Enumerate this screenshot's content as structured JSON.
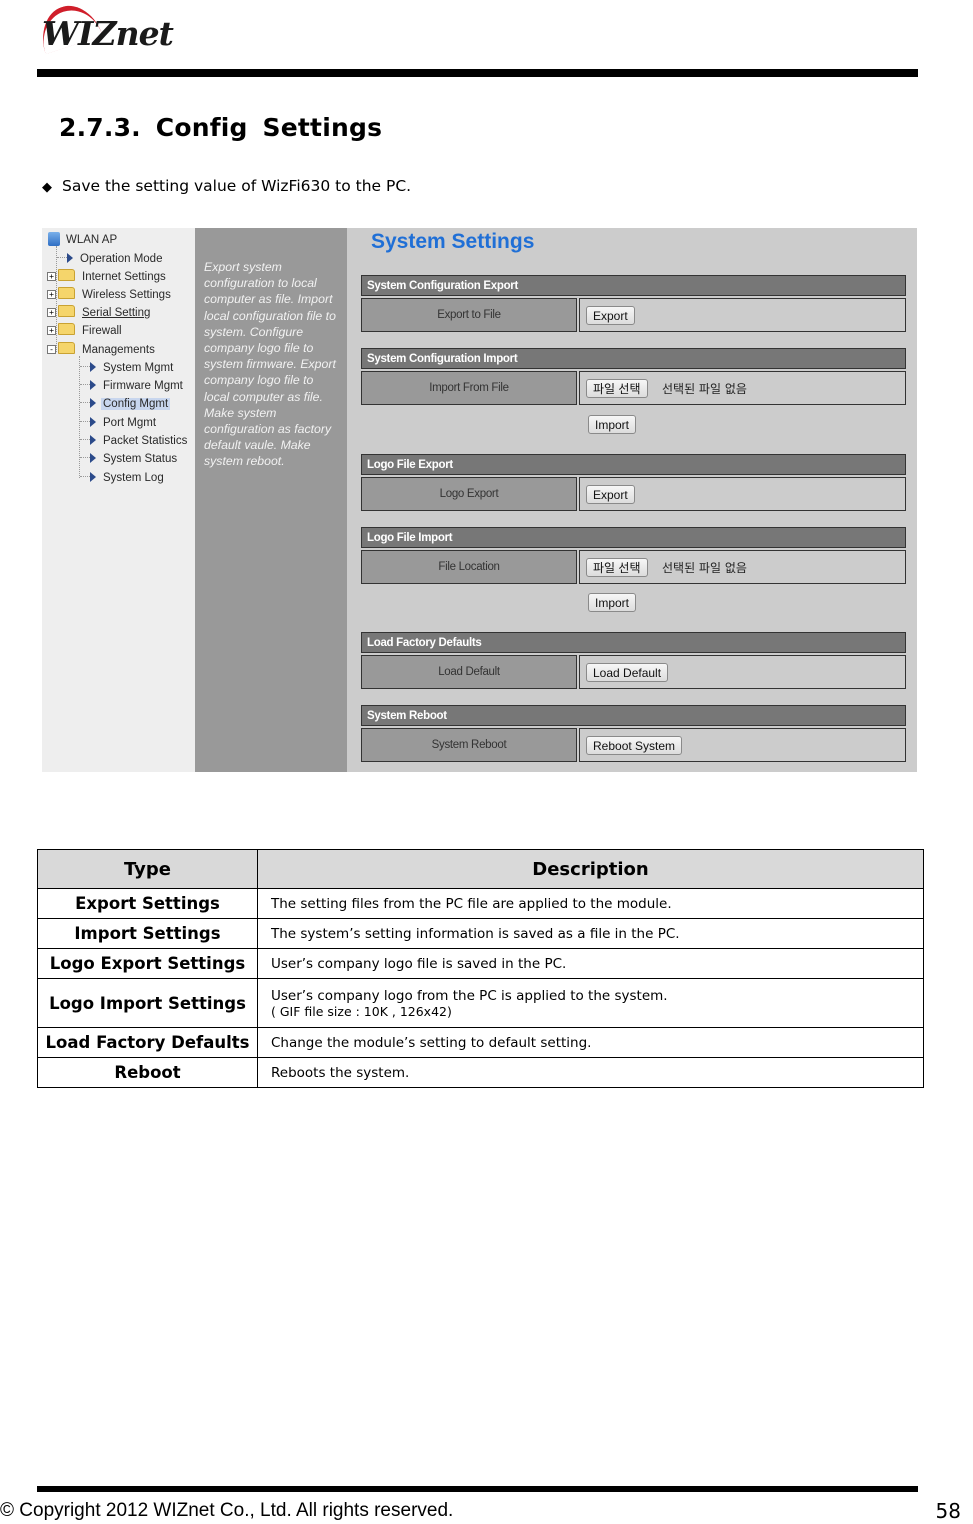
{
  "header": {
    "logo_text": "WIZnet",
    "section_title": "2.7.3.  Config  Settings",
    "bullet_icon": "black-diamond",
    "bullet_glyph": "◆",
    "bullet_text": "Save the setting value of WizFi630 to the PC."
  },
  "screenshot": {
    "tree": {
      "root": "WLAN AP",
      "items": [
        {
          "label": "Operation Mode",
          "kind": "page"
        },
        {
          "label": "Internet Settings",
          "kind": "folder",
          "expander": "+"
        },
        {
          "label": "Wireless Settings",
          "kind": "folder",
          "expander": "+"
        },
        {
          "label": "Serial Setting",
          "kind": "folder",
          "expander": "+"
        },
        {
          "label": "Firewall",
          "kind": "folder",
          "expander": "+"
        },
        {
          "label": "Managements",
          "kind": "folder",
          "expander": "-"
        }
      ],
      "children": [
        {
          "label": "System Mgmt"
        },
        {
          "label": "Firmware Mgmt"
        },
        {
          "label": "Config Mgmt",
          "selected": true
        },
        {
          "label": "Port Mgmt"
        },
        {
          "label": "Packet Statistics"
        },
        {
          "label": "System Status"
        },
        {
          "label": "System Log"
        }
      ]
    },
    "help_text": "Export system configuration to local computer as file. Import local configuration file to system. Configure company logo file to system firmware. Export company logo file to local computer as file. Make system configuration as factory default vaule. Make system reboot.",
    "title": "System Settings",
    "title_color": "#1f6fd6",
    "sections": [
      {
        "header": "System Configuration Export",
        "label": "Export to File",
        "button": "Export"
      },
      {
        "header": "System Configuration Import",
        "label": "Import From File",
        "file_button": "파일 선택",
        "file_status": "선택된 파일 없음",
        "submit": "Import"
      },
      {
        "header": "Logo File Export",
        "label": "Logo Export",
        "button": "Export"
      },
      {
        "header": "Logo File Import",
        "label": "File Location",
        "file_button": "파일 선택",
        "file_status": "선택된 파일 없음",
        "submit": "Import"
      },
      {
        "header": "Load Factory Defaults",
        "label": "Load Default",
        "button": "Load Default"
      },
      {
        "header": "System Reboot",
        "label": "System Reboot",
        "button": "Reboot System"
      }
    ]
  },
  "table": {
    "headers": [
      "Type",
      "Description"
    ],
    "rows": [
      {
        "type": "Export Settings",
        "description": "The setting files from the PC file are applied to the module."
      },
      {
        "type": "Import Settings",
        "description": "The system’s setting information is saved as a file in the PC."
      },
      {
        "type": "Logo Export Settings",
        "description": "User’s company logo file is saved in the PC."
      },
      {
        "type": "Logo Import Settings",
        "description": "User’s company logo from the PC is applied to the system.",
        "description_line2": "( GIF file size : 10K ,   126x42)"
      },
      {
        "type": "Load Factory Defaults",
        "description": "Change the module’s setting to default setting."
      },
      {
        "type": "Reboot",
        "description": "Reboots the system."
      }
    ]
  },
  "footer": {
    "copyright": "© Copyright 2012 WIZnet Co., Ltd. All rights reserved.",
    "page_number": "58"
  }
}
